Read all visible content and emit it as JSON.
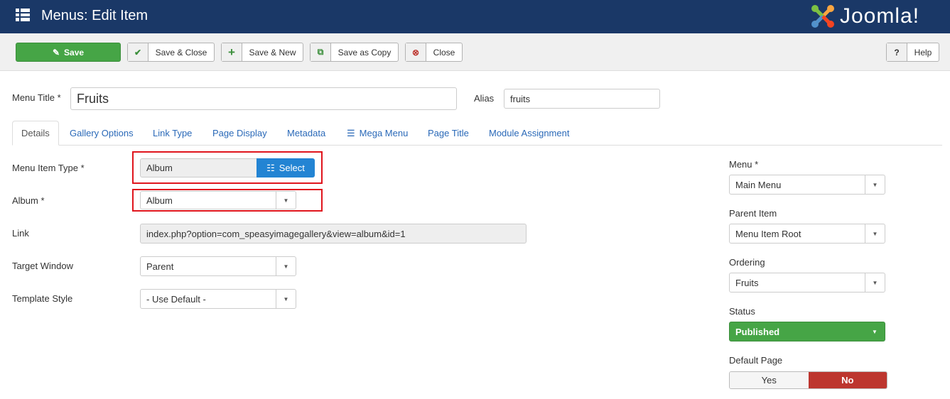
{
  "header": {
    "title": "Menus: Edit Item",
    "logo_text": "Joomla!"
  },
  "toolbar": {
    "save": "Save",
    "save_close": "Save & Close",
    "save_new": "Save & New",
    "save_copy": "Save as Copy",
    "close": "Close",
    "help": "Help"
  },
  "form": {
    "menu_title_label": "Menu Title *",
    "menu_title_value": "Fruits",
    "alias_label": "Alias",
    "alias_value": "fruits"
  },
  "tabs": [
    "Details",
    "Gallery Options",
    "Link Type",
    "Page Display",
    "Metadata",
    "Mega Menu",
    "Page Title",
    "Module Assignment"
  ],
  "details": {
    "type_label": "Menu Item Type *",
    "type_value": "Album",
    "select_button": "Select",
    "album_label": "Album *",
    "album_value": "Album",
    "link_label": "Link",
    "link_value": "index.php?option=com_speasyimagegallery&view=album&id=1",
    "target_label": "Target Window",
    "target_value": "Parent",
    "template_label": "Template Style",
    "template_value": "- Use Default -"
  },
  "sidebar": {
    "menu_label": "Menu *",
    "menu_value": "Main Menu",
    "parent_label": "Parent Item",
    "parent_value": "Menu Item Root",
    "ordering_label": "Ordering",
    "ordering_value": "Fruits",
    "status_label": "Status",
    "status_value": "Published",
    "default_label": "Default Page",
    "yes": "Yes",
    "no": "No"
  },
  "colors": {
    "header": "#1a3867",
    "save": "#46a546",
    "published": "#46a546",
    "no": "#bd362f",
    "highlight": "#e0151d"
  }
}
